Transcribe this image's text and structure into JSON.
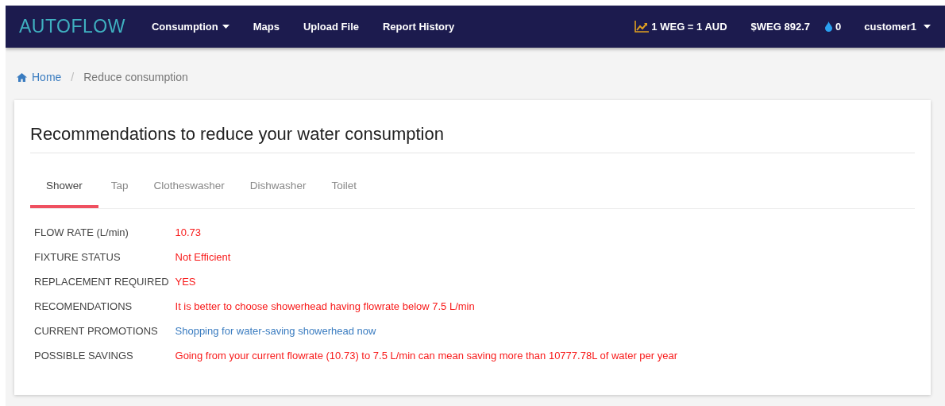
{
  "navbar": {
    "logo": "AUTOFLOW",
    "menu": [
      {
        "label": "Consumption",
        "dropdown": true
      },
      {
        "label": "Maps",
        "dropdown": false
      },
      {
        "label": "Upload File",
        "dropdown": false
      },
      {
        "label": "Report History",
        "dropdown": false
      }
    ],
    "rate": "1 WEG = 1 AUD",
    "balance": "$WEG 892.7",
    "drops": "0",
    "user": "customer1"
  },
  "breadcrumb_separator": "/",
  "breadcrumb": [
    {
      "label": "Home",
      "kind": "link"
    },
    {
      "label": "Reduce consumption",
      "kind": "current"
    }
  ],
  "card": {
    "title": "Recommendations to reduce your water consumption",
    "tabs": [
      {
        "label": "Shower",
        "selected": true
      },
      {
        "label": "Tap",
        "selected": false
      },
      {
        "label": "Clotheswasher",
        "selected": false
      },
      {
        "label": "Dishwasher",
        "selected": false
      },
      {
        "label": "Toilet",
        "selected": false
      }
    ],
    "rows": [
      {
        "label": "FLOW RATE (L/min)",
        "value": "10.73",
        "kind": "alert"
      },
      {
        "label": "FIXTURE STATUS",
        "value": "Not Efficient",
        "kind": "alert"
      },
      {
        "label": "REPLACEMENT REQUIRED",
        "value": "YES",
        "kind": "alert"
      },
      {
        "label": "RECOMENDATIONS",
        "value": "It is better to choose showerhead having flowrate below 7.5 L/min",
        "kind": "alert"
      },
      {
        "label": "CURRENT PROMOTIONS",
        "value": "Shopping for water-saving showerhead now",
        "kind": "link"
      },
      {
        "label": "POSSIBLE SAVINGS",
        "value": "Going from your current flowrate (10.73) to 7.5 L/min can mean saving more than 10777.78L of water per year",
        "kind": "alert"
      }
    ]
  }
}
